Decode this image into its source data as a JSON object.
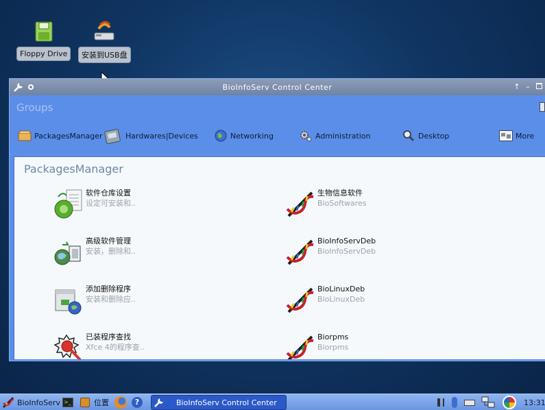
{
  "desktop": {
    "icons": [
      {
        "label": "Floppy Drive",
        "icon": "floppy-drive-icon"
      },
      {
        "label": "安装到USB盘",
        "icon": "usb-install-icon"
      }
    ]
  },
  "window": {
    "title": "BioInfoServ Control Center",
    "groups_label": "Groups",
    "categories": [
      {
        "label": "PackagesManager",
        "icon": "package-icon"
      },
      {
        "label": "Hardwares|Devices",
        "icon": "hardware-icon"
      },
      {
        "label": "Networking",
        "icon": "globe-icon"
      },
      {
        "label": "Administration",
        "icon": "gears-icon"
      },
      {
        "label": "Desktop",
        "icon": "magnifier-icon"
      },
      {
        "label": "More",
        "icon": "more-icon"
      }
    ],
    "panel": {
      "title": "PackagesManager",
      "items": [
        {
          "name": "软件仓库设置",
          "desc": "设定可安装和..",
          "icon": "repository-settings-icon"
        },
        {
          "name": "生物信息软件",
          "desc": "BioSoftwares",
          "icon": "dna-icon"
        },
        {
          "name": "高级软件管理",
          "desc": "安装，删除和..",
          "icon": "advanced-package-icon"
        },
        {
          "name": "BioInfoServDeb",
          "desc": "BioInfoServDeb",
          "icon": "dna-icon"
        },
        {
          "name": "添加删除程序",
          "desc": "安装和删除应..",
          "icon": "add-remove-icon"
        },
        {
          "name": "BioLinuxDeb",
          "desc": "BioLinuxDeb",
          "icon": "dna-icon"
        },
        {
          "name": "已装程序查找",
          "desc": "Xfce 4的程序查..",
          "icon": "installed-search-icon"
        },
        {
          "name": "Biorpms",
          "desc": "Biorpms",
          "icon": "dna-icon"
        }
      ]
    }
  },
  "taskbar": {
    "start_label": "BioInfoServ",
    "places_label": "位置",
    "active_window": "BioInfoServ Control Center",
    "clock": "13:31"
  },
  "colors": {
    "window_body": "#5b8ee9",
    "titlebar": "#7d8fae",
    "panel_bg": "#f5f9fb",
    "taskbar": "#7fa7e9",
    "active_task": "#2b59c8"
  }
}
